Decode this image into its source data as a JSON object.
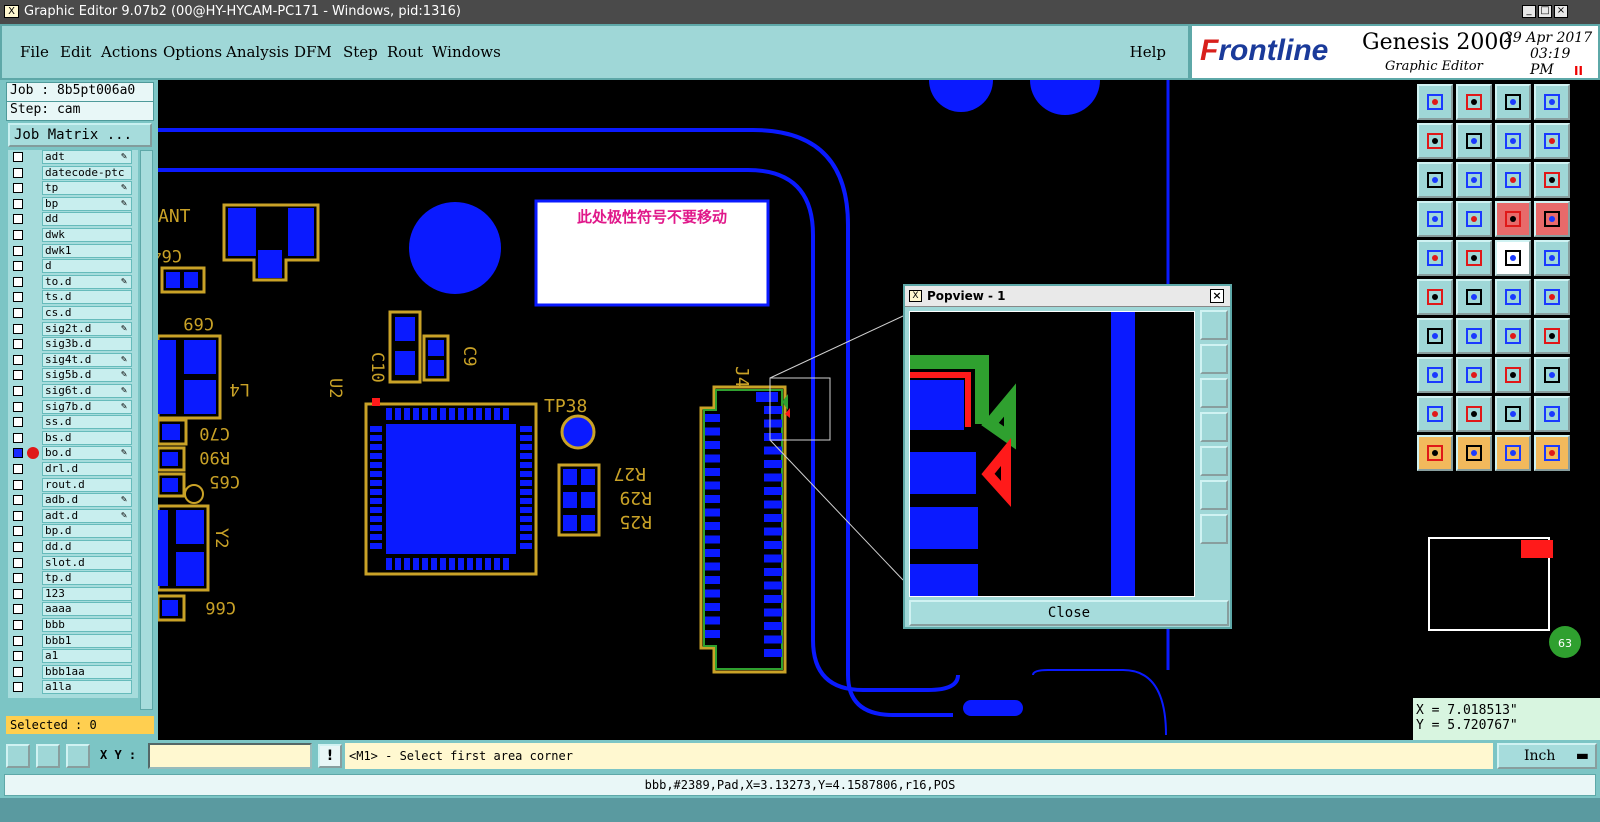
{
  "window": {
    "title": "Graphic Editor 9.07b2 (00@HY-HYCAM-PC171 - Windows, pid:1316)",
    "icon_glyph": "X",
    "minimize": "_",
    "maximize": "□",
    "close": "×"
  },
  "menu": {
    "items": [
      "File",
      "Edit",
      "Actions",
      "Options",
      "Analysis",
      "DFM",
      "Step",
      "Rout",
      "Windows"
    ],
    "help": "Help"
  },
  "brand": {
    "logo_f": "F",
    "logo_rest": "rontline",
    "product": "Genesis 2000",
    "subtitle": "Graphic Editor",
    "date": "29 Apr 2017",
    "time": "03:19 PM",
    "pause": "II"
  },
  "left_panel": {
    "job": "Job : 8b5pt006a0",
    "step": "Step: cam",
    "job_matrix": "Job Matrix ...",
    "selected": "Selected : 0",
    "layers": [
      {
        "name": "adt",
        "pen": true
      },
      {
        "name": "datecode-ptc",
        "pen": false
      },
      {
        "name": "tp",
        "pen": true
      },
      {
        "name": "bp",
        "pen": true
      },
      {
        "name": "dd",
        "pen": false
      },
      {
        "name": "dwk",
        "pen": false
      },
      {
        "name": "dwk1",
        "pen": false
      },
      {
        "name": "d",
        "pen": false
      },
      {
        "name": "to.d",
        "pen": true
      },
      {
        "name": "ts.d",
        "pen": false
      },
      {
        "name": "cs.d",
        "pen": false
      },
      {
        "name": "sig2t.d",
        "pen": true
      },
      {
        "name": "sig3b.d",
        "pen": false
      },
      {
        "name": "sig4t.d",
        "pen": true
      },
      {
        "name": "sig5b.d",
        "pen": true
      },
      {
        "name": "sig6t.d",
        "pen": true
      },
      {
        "name": "sig7b.d",
        "pen": true
      },
      {
        "name": "ss.d",
        "pen": false
      },
      {
        "name": "bs.d",
        "pen": false
      },
      {
        "name": "bo.d",
        "pen": true,
        "active": true
      },
      {
        "name": "drl.d",
        "pen": false
      },
      {
        "name": "rout.d",
        "pen": false
      },
      {
        "name": "adb.d",
        "pen": true
      },
      {
        "name": "adt.d",
        "pen": true
      },
      {
        "name": "bp.d",
        "pen": false
      },
      {
        "name": "dd.d",
        "pen": false
      },
      {
        "name": "slot.d",
        "pen": false
      },
      {
        "name": "tp.d",
        "pen": false
      },
      {
        "name": "123",
        "pen": false
      },
      {
        "name": "aaaa",
        "pen": false
      },
      {
        "name": "bbb",
        "pen": false
      },
      {
        "name": "bbb1",
        "pen": false
      },
      {
        "name": "a1",
        "pen": false
      },
      {
        "name": "bbb1aa",
        "pen": false
      },
      {
        "name": "a1la",
        "pen": false
      }
    ]
  },
  "canvas": {
    "note_text": "此处极性符号不要移动",
    "labels": {
      "ant": "ANT",
      "c64": "C64",
      "c69": "C69",
      "l4": "L4",
      "c70": "C70",
      "r90": "R90",
      "c65": "C65",
      "y2": "Y2",
      "c66": "C66",
      "c10": "C10",
      "c9": "C9",
      "u2": "U2",
      "tp38": "TP38",
      "r27": "R27",
      "r29": "R29",
      "r25": "R25",
      "j4": "J4"
    },
    "colors": {
      "copper": "#0a1aff",
      "silk": "#c9a227",
      "outline": "#2fa02f",
      "polarity": "#ff1a1a",
      "note": "#e0188a"
    }
  },
  "popview": {
    "title": "Popview - 1",
    "close_x": "×",
    "close_button": "Close"
  },
  "right_panel": {
    "x": "X = 7.018513\"",
    "y": "Y = 5.720767\"",
    "badge": "63"
  },
  "command": {
    "xy_label": "X Y :",
    "xy_value": "",
    "info": "!",
    "message": "<M1> - Select first area corner",
    "units": "Inch"
  },
  "status": {
    "line": "bbb,#2389,Pad,X=3.13273,Y=4.1587806,r16,POS"
  }
}
